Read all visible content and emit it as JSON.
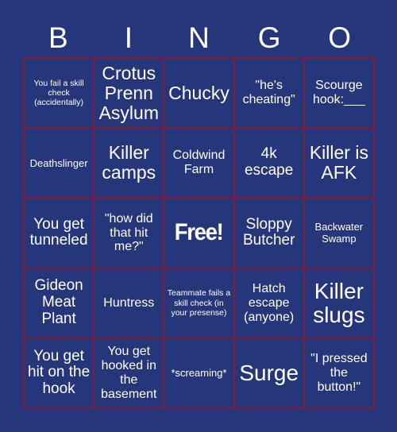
{
  "card": {
    "title": "BINGO",
    "header_letters": [
      "B",
      "I",
      "N",
      "G",
      "O"
    ],
    "colors": {
      "background": "#26367a",
      "grid_line": "#7e1d3e",
      "text": "#ffffff"
    },
    "rows": [
      [
        {
          "text": "You fail a skill check (accidentally)",
          "size": "xs",
          "free": false
        },
        {
          "text": "Crotus Prenn Asylum",
          "size": "xl",
          "free": false
        },
        {
          "text": "Chucky",
          "size": "xl",
          "free": false
        },
        {
          "text": "\"he's cheating\"",
          "size": "md",
          "free": false
        },
        {
          "text": "Scourge hook:___",
          "size": "md",
          "free": false
        }
      ],
      [
        {
          "text": "Deathslinger",
          "size": "sm",
          "free": false
        },
        {
          "text": "Killer camps",
          "size": "xl",
          "free": false
        },
        {
          "text": "Coldwind Farm",
          "size": "md",
          "free": false
        },
        {
          "text": "4k escape",
          "size": "lg",
          "free": false
        },
        {
          "text": "Killer is AFK",
          "size": "xl",
          "free": false
        }
      ],
      [
        {
          "text": "You get tunneled",
          "size": "lg",
          "free": false
        },
        {
          "text": "\"how did that hit me?\"",
          "size": "md",
          "free": false
        },
        {
          "text": "Free!",
          "size": "free",
          "free": true
        },
        {
          "text": "Sloppy Butcher",
          "size": "lg",
          "free": false
        },
        {
          "text": "Backwater Swamp",
          "size": "sm",
          "free": false
        }
      ],
      [
        {
          "text": "Gideon Meat Plant",
          "size": "lg",
          "free": false
        },
        {
          "text": "Huntress",
          "size": "md",
          "free": false
        },
        {
          "text": "Teammate fails a skill check (in your presense)",
          "size": "xs",
          "free": false
        },
        {
          "text": "Hatch escape (anyone)",
          "size": "md",
          "free": false
        },
        {
          "text": "Killer slugs",
          "size": "xxl",
          "free": false
        }
      ],
      [
        {
          "text": "You get hit on the hook",
          "size": "lg",
          "free": false
        },
        {
          "text": "You get hooked in the basement",
          "size": "md",
          "free": false
        },
        {
          "text": "*screaming*",
          "size": "sm",
          "free": false
        },
        {
          "text": "Surge",
          "size": "xxl",
          "free": false
        },
        {
          "text": "\"I pressed the button!\"",
          "size": "md",
          "free": false
        }
      ]
    ]
  }
}
